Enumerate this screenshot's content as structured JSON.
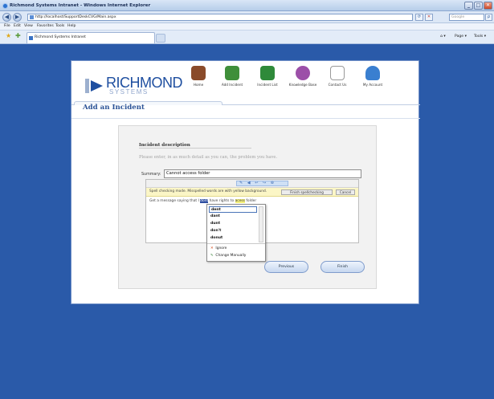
{
  "window": {
    "title": "Richmond Systems Intranet - Windows Internet Explorer",
    "address": "http://localhost/SupportDeskCVG/Main.aspx",
    "search_placeholder": "Google",
    "buttons": {
      "minimize": "_",
      "maximize": "□",
      "close": "✕",
      "back": "◀",
      "forward": "▶",
      "refresh": "⟳",
      "stop": "✕",
      "search_go": "ρ"
    }
  },
  "menu": [
    "File",
    "Edit",
    "View",
    "Favorites",
    "Tools",
    "Help"
  ],
  "tabbar": {
    "tab_label": "Richmond Systems Intranet",
    "commands": [
      "Page ▾",
      "Tools ▾"
    ]
  },
  "site": {
    "logo": {
      "name": "RICHMOND",
      "sub": "SYSTEMS"
    },
    "nav": [
      {
        "label": "Home",
        "color": "#8a4b2a"
      },
      {
        "label": "Add Incident",
        "color": "#3f8f3a"
      },
      {
        "label": "Incident List",
        "color": "#2f8a3a"
      },
      {
        "label": "Knowledge Base",
        "color": "#9c4fa8"
      },
      {
        "label": "Contact Us",
        "color": "#b9b9b9"
      },
      {
        "label": "My Account",
        "color": "#3a7fd0"
      }
    ],
    "page_title": "Add an Incident"
  },
  "form": {
    "heading": "Incident description",
    "hint": "Please enter, in as much detail as you can, the problem you have.",
    "summary_label": "Summary:",
    "summary_value": "Cannot access folder",
    "toolbar_icons": "✎ ◀ ↩ ↪ ⊕",
    "spell_message": "Spell checking mode. Misspelled words are with yellow background.",
    "finish_spell": "Finish spellchecking",
    "cancel": "Cancel",
    "body_text_before": "Get a message saying that I",
    "body_selected": "dont",
    "body_text_mid": "have rights to",
    "body_misspelled": "acess",
    "body_text_after": "folder",
    "suggestions": [
      "dent",
      "dant",
      "dunt",
      "don't",
      "donut"
    ],
    "ignore": "Ignore",
    "change_manually": "Change Manually",
    "previous": "Previous",
    "finish": "Finish"
  }
}
